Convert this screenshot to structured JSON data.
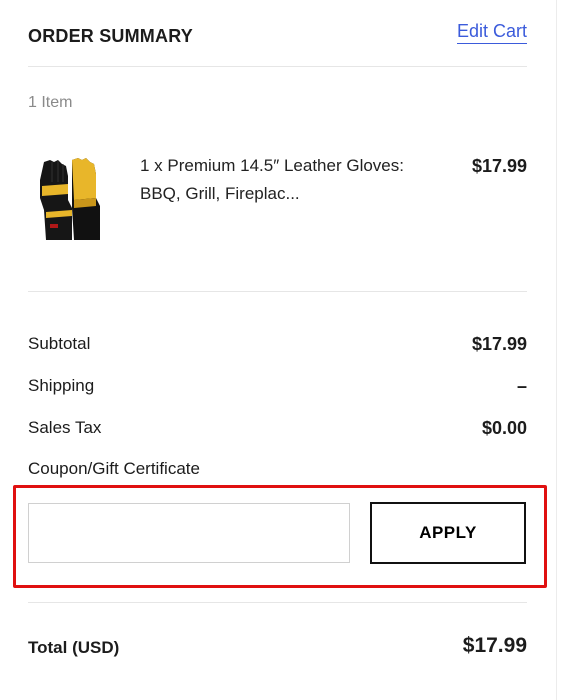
{
  "header": {
    "title": "ORDER SUMMARY",
    "edit_cart_label": "Edit Cart"
  },
  "cart": {
    "item_count": "1 Item",
    "product": {
      "name": "1 x Premium 14.5″ Leather Gloves: BBQ, Grill, Fireplac...",
      "price": "$17.99",
      "image_icon": "leather-gloves-image",
      "colors": {
        "yellow": "#e8b62a",
        "black": "#111111"
      }
    }
  },
  "totals": {
    "rows": [
      {
        "label": "Subtotal",
        "value": "$17.99"
      },
      {
        "label": "Shipping",
        "value": "–"
      },
      {
        "label": "Sales Tax",
        "value": "$0.00"
      }
    ]
  },
  "coupon": {
    "label": "Coupon/Gift Certificate",
    "input_value": "",
    "apply_label": "APPLY",
    "highlight_color": "#e01010"
  },
  "grand_total": {
    "label": "Total (USD)",
    "value": "$17.99"
  }
}
